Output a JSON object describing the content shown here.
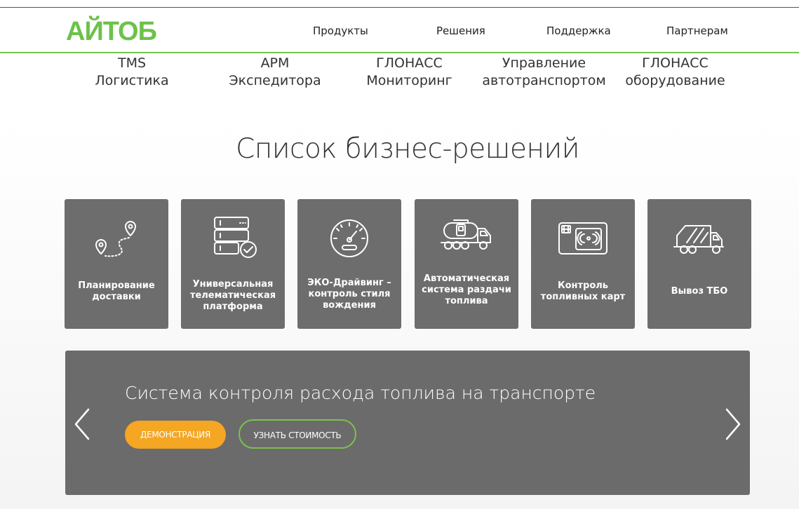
{
  "header": {
    "logo": "АЙТОБ",
    "nav": [
      "Продукты",
      "Решения",
      "Поддержка",
      "Партнерам"
    ]
  },
  "subnav": [
    {
      "line1": "TMS",
      "line2": "Логистика"
    },
    {
      "line1": "АРМ",
      "line2": "Экспедитора"
    },
    {
      "line1": "ГЛОНАСС",
      "line2": "Мониторинг"
    },
    {
      "line1": "Управление",
      "line2": "автотранспортом"
    },
    {
      "line1": "ГЛОНАСС",
      "line2": "оборудование"
    }
  ],
  "section_title": "Список бизнес-решений",
  "cards": [
    {
      "icon": "route-pins-icon",
      "lines": [
        "Планирование",
        "доставки"
      ]
    },
    {
      "icon": "server-check-icon",
      "lines": [
        "Универсальная",
        "телематическая",
        "платформа"
      ]
    },
    {
      "icon": "speedometer-icon",
      "lines": [
        "ЭКО-Драйвинг –",
        "контроль стиля",
        "вождения"
      ]
    },
    {
      "icon": "fuel-tanker-icon",
      "lines": [
        "Автоматическая",
        "система раздачи",
        "топлива"
      ]
    },
    {
      "icon": "fuel-card-icon",
      "lines": [
        "Контроль",
        "топливных карт"
      ]
    },
    {
      "icon": "garbage-truck-icon",
      "lines": [
        "Вывоз ТБО"
      ]
    }
  ],
  "banner": {
    "title": "Система контроля расхода топлива на транспорте",
    "demo_button": "ДЕМОНСТРАЦИЯ",
    "price_button": "УЗНАТЬ СТОИМОСТЬ"
  },
  "colors": {
    "brand_green": "#6cc24a",
    "accent_orange": "#f5a623",
    "card_gray": "#6d6d6d"
  }
}
